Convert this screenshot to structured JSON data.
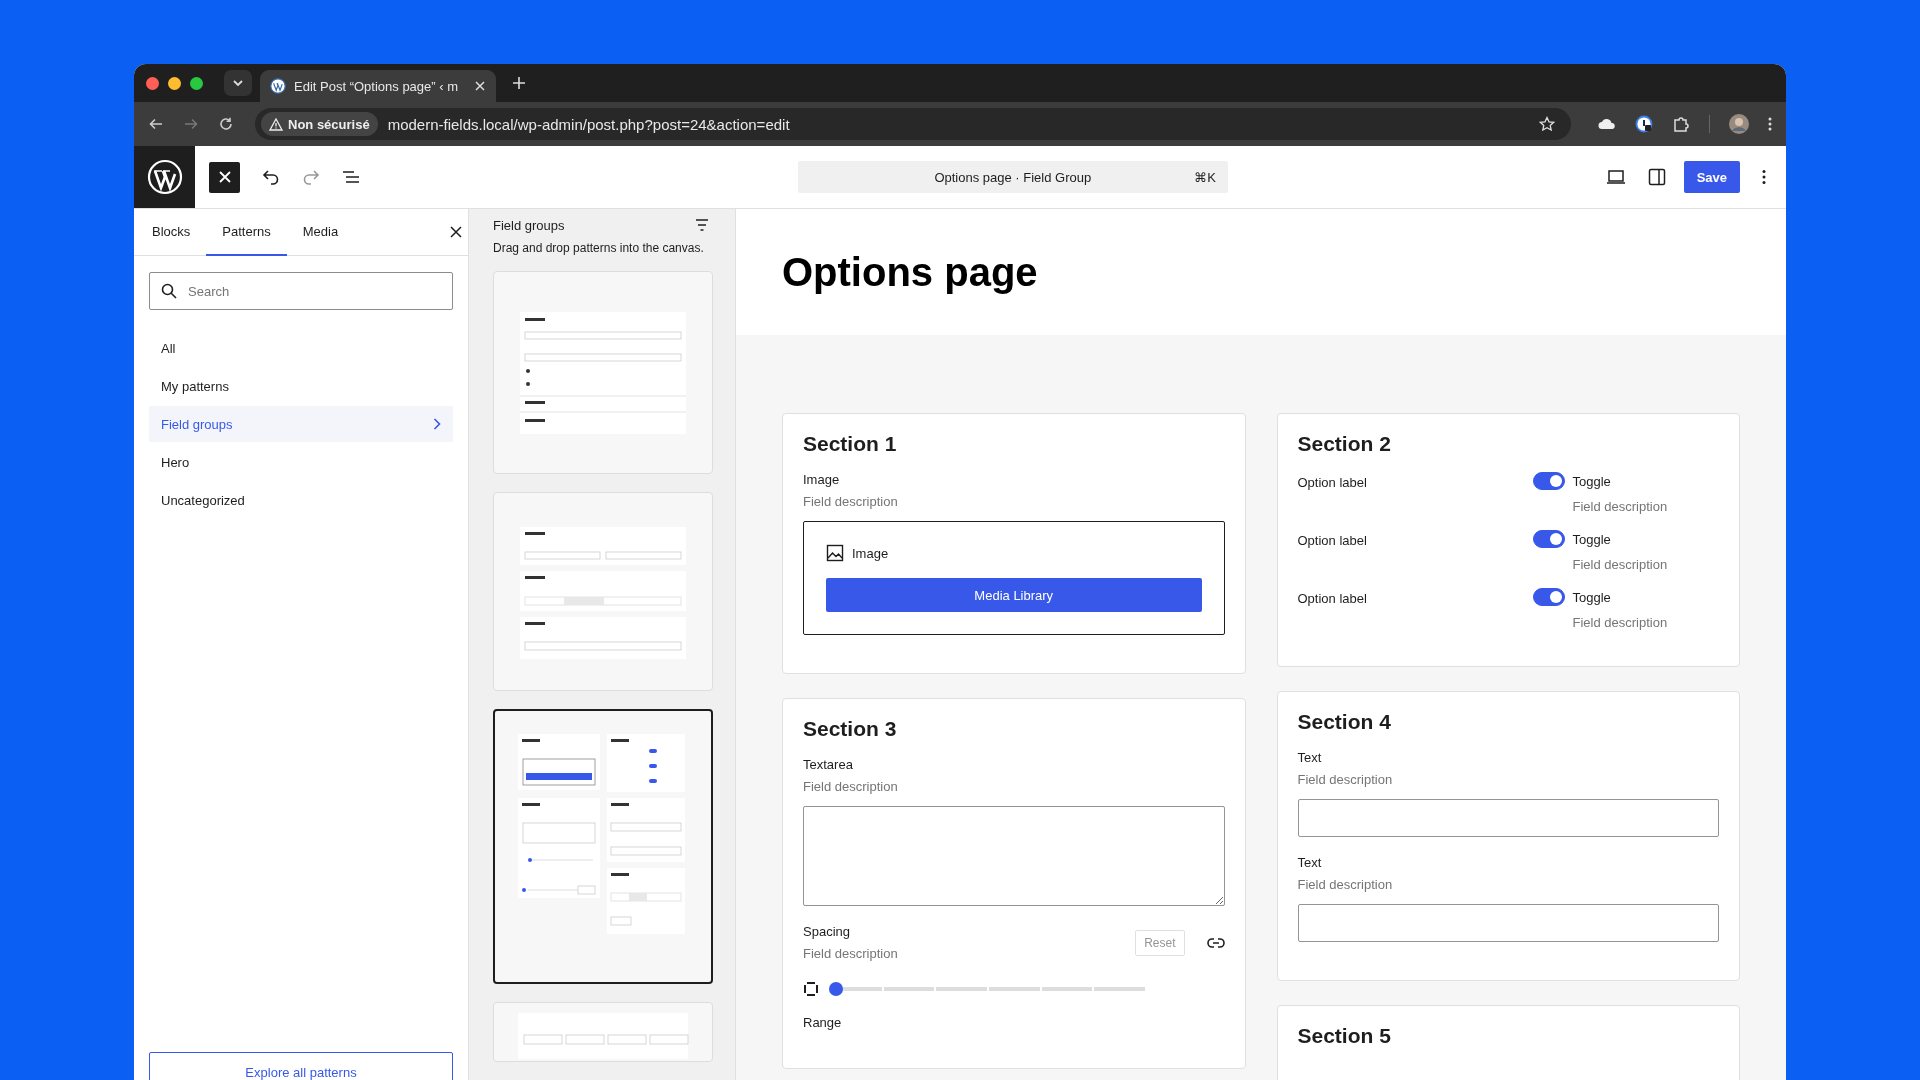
{
  "browser": {
    "tab_title": "Edit Post “Options page” ‹ m",
    "security_label": "Non sécurisé",
    "url": "modern-fields.local/wp-admin/post.php?post=24&action=edit"
  },
  "toolbar": {
    "command": "Options page · Field Group",
    "shortcut": "⌘K",
    "save": "Save"
  },
  "inserter": {
    "tabs": [
      {
        "label": "Blocks",
        "selected": false
      },
      {
        "label": "Patterns",
        "selected": true
      },
      {
        "label": "Media",
        "selected": false
      }
    ],
    "search": {
      "placeholder": "Search"
    },
    "categories": [
      {
        "label": "All",
        "selected": false
      },
      {
        "label": "My patterns",
        "selected": false
      },
      {
        "label": "Field groups",
        "selected": true
      },
      {
        "label": "Hero",
        "selected": false
      },
      {
        "label": "Uncategorized",
        "selected": false
      }
    ],
    "explore": "Explore all patterns"
  },
  "patterns": {
    "title": "Field groups",
    "hint": "Drag and drop patterns into the canvas.",
    "previews": [
      {
        "kind": "accordion",
        "selected": false
      },
      {
        "kind": "stacked",
        "selected": false
      },
      {
        "kind": "grid",
        "selected": true
      },
      {
        "kind": "row",
        "selected": false
      }
    ]
  },
  "canvas": {
    "title": "Options page",
    "columns": [
      {
        "sections": [
          {
            "title": "Section 1",
            "fields": [
              {
                "kind": "image",
                "label": "Image",
                "description": "Field description",
                "box_label": "Image",
                "button": "Media Library"
              }
            ]
          },
          {
            "title": "Section 3",
            "fields": [
              {
                "kind": "textarea",
                "label": "Textarea",
                "description": "Field description"
              },
              {
                "kind": "spacing",
                "label": "Spacing",
                "description": "Field description",
                "reset": "Reset",
                "level": 0
              },
              {
                "kind": "range",
                "label": "Range"
              }
            ]
          }
        ]
      },
      {
        "sections": [
          {
            "title": "Section 2",
            "fields": [
              {
                "kind": "toggle",
                "label": "Option label",
                "toggle_label": "Toggle",
                "description": "Field description",
                "on": true
              },
              {
                "kind": "toggle",
                "label": "Option label",
                "toggle_label": "Toggle",
                "description": "Field description",
                "on": true
              },
              {
                "kind": "toggle",
                "label": "Option label",
                "toggle_label": "Toggle",
                "description": "Field description",
                "on": true
              }
            ]
          },
          {
            "title": "Section 4",
            "fields": [
              {
                "kind": "text",
                "label": "Text",
                "description": "Field description"
              },
              {
                "kind": "text",
                "label": "Text",
                "description": "Field description"
              }
            ]
          },
          {
            "title": "Section 5"
          }
        ]
      }
    ]
  }
}
